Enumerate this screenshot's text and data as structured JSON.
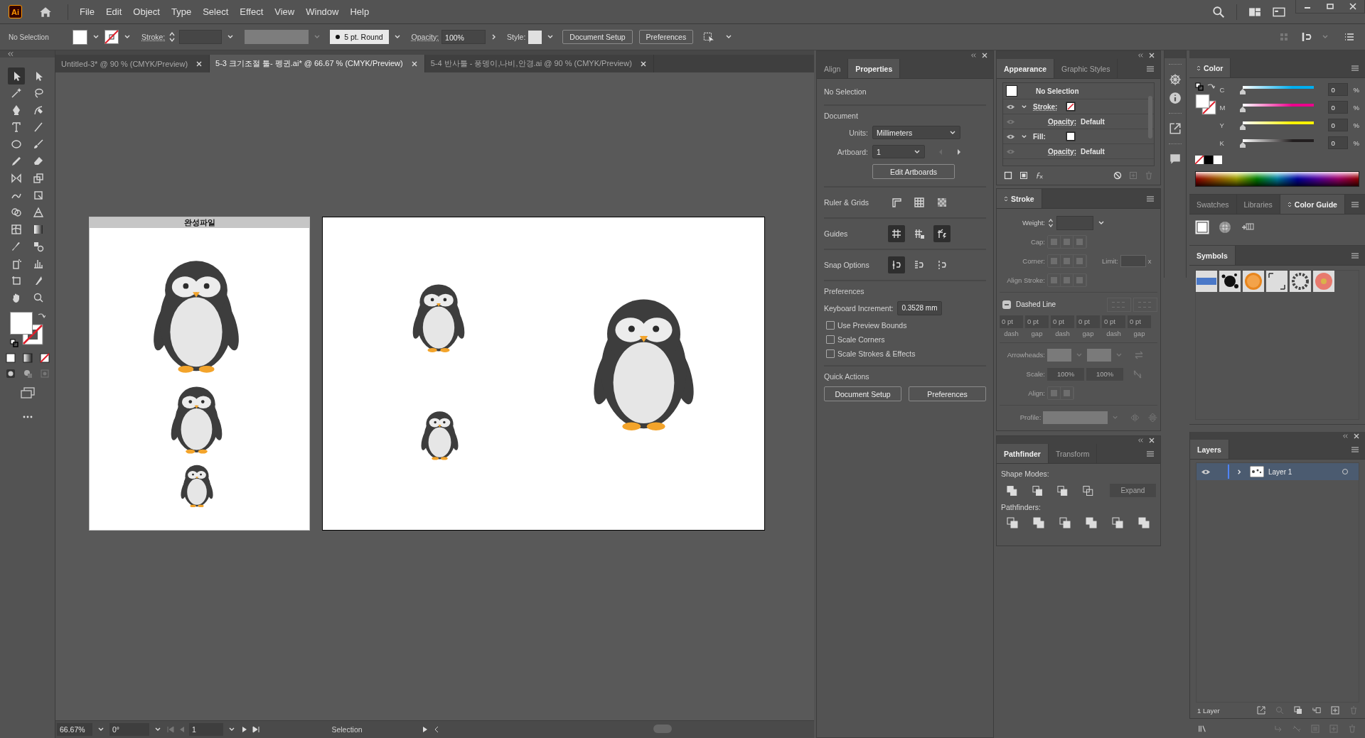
{
  "app": {
    "logo": "Ai"
  },
  "menu": [
    "File",
    "Edit",
    "Object",
    "Type",
    "Select",
    "Effect",
    "View",
    "Window",
    "Help"
  ],
  "control_bar": {
    "selection": "No Selection",
    "stroke_label": "Stroke:",
    "brush": "5 pt. Round",
    "opacity_label": "Opacity:",
    "opacity": "100%",
    "style_label": "Style:",
    "buttons": [
      "Document Setup",
      "Preferences"
    ]
  },
  "document_tabs": [
    {
      "label": "Untitled-3* @ 90 % (CMYK/Preview)",
      "selected": false
    },
    {
      "label": "5-3 크기조절 툴- 펭귄.ai* @ 66.67 % (CMYK/Preview)",
      "selected": true
    },
    {
      "label": "5-4 반사툴 - 풍뎅이,나비,안경.ai @ 90 % (CMYK/Preview)",
      "selected": false
    }
  ],
  "artboards": [
    {
      "kind": "titled",
      "title": "완성파일"
    },
    {
      "kind": "plain"
    }
  ],
  "properties": {
    "tabs": [
      {
        "label": "Align",
        "selected": false
      },
      {
        "label": "Properties",
        "selected": true
      }
    ],
    "selection": "No Selection",
    "document_heading": "Document",
    "units_label": "Units:",
    "units": "Millimeters",
    "artboard_label": "Artboard:",
    "artboard": "1",
    "edit_button": "Edit Artboards",
    "rows": [
      {
        "label": "Ruler & Grids",
        "icons": [
          {
            "on": false
          },
          {
            "on": false
          },
          {
            "on": false
          }
        ]
      },
      {
        "label": "Guides",
        "icons": [
          {
            "on": true
          },
          {
            "on": false
          },
          {
            "on": true
          }
        ]
      },
      {
        "label": "Snap Options",
        "icons": [
          {
            "on": true
          },
          {
            "on": false
          },
          {
            "on": false
          }
        ]
      }
    ],
    "preferences_heading": "Preferences",
    "keyboard_label": "Keyboard Increment:",
    "keyboard_value": "0.3528 mm",
    "checkboxes": [
      {
        "label": "Use Preview Bounds",
        "checked": false
      },
      {
        "label": "Scale Corners",
        "checked": false
      },
      {
        "label": "Scale Strokes & Effects",
        "checked": false
      }
    ],
    "quick_actions_heading": "Quick Actions",
    "quick_buttons": [
      "Document Setup",
      "Preferences"
    ]
  },
  "appearance": {
    "tabs": [
      {
        "label": "Appearance",
        "selected": true
      },
      {
        "label": "Graphic Styles",
        "selected": false
      }
    ],
    "title": "No Selection",
    "rows": [
      {
        "kind": "stroke",
        "label": "Stroke:"
      },
      {
        "kind": "opacity",
        "label": "Opacity:",
        "value": "Default"
      },
      {
        "kind": "fill",
        "label": "Fill:"
      },
      {
        "kind": "opacity",
        "label": "Opacity:",
        "value": "Default"
      }
    ]
  },
  "stroke": {
    "title": "Stroke",
    "weight_label": "Weight:",
    "cap_label": "Cap:",
    "corner_label": "Corner:",
    "limit_label": "Limit:",
    "limit_unit": "x",
    "align_label": "Align Stroke:",
    "dashed_label": "Dashed Line",
    "dashed_checked": true,
    "dashes": [
      {
        "value": "0 pt",
        "label": "dash"
      },
      {
        "value": "0 pt",
        "label": "gap"
      },
      {
        "value": "0 pt",
        "label": "dash"
      },
      {
        "value": "0 pt",
        "label": "gap"
      },
      {
        "value": "0 pt",
        "label": "dash"
      },
      {
        "value": "0 pt",
        "label": "gap"
      }
    ],
    "arrowheads_label": "Arrowheads:",
    "scale_label": "Scale:",
    "scales": [
      "100%",
      "100%"
    ],
    "arrow_align_label": "Align:",
    "profile_label": "Profile:"
  },
  "pathfinder": {
    "tabs": [
      {
        "label": "Pathfinder",
        "selected": true
      },
      {
        "label": "Transform",
        "selected": false
      }
    ],
    "shape_modes": "Shape Modes:",
    "expand": "Expand",
    "pathfinders": "Pathfinders:"
  },
  "color": {
    "title": "Color",
    "channels": [
      {
        "name": "C",
        "value": "0",
        "unit": "%",
        "color": "#00aeef",
        "level": 0
      },
      {
        "name": "M",
        "value": "0",
        "unit": "%",
        "color": "#ec008c",
        "level": 0
      },
      {
        "name": "Y",
        "value": "0",
        "unit": "%",
        "color": "#fff200",
        "level": 0
      },
      {
        "name": "K",
        "value": "0",
        "unit": "%",
        "color": "#231f20",
        "level": 0
      }
    ]
  },
  "swatch_tabs": [
    {
      "label": "Swatches",
      "selected": false
    },
    {
      "label": "Libraries",
      "selected": false
    },
    {
      "label": "Color Guide",
      "selected": true
    }
  ],
  "symbols": {
    "title": "Symbols"
  },
  "layers": {
    "title": "Layers",
    "items": [
      {
        "name": "Layer 1",
        "visible": true,
        "selected": true,
        "expanded": false
      }
    ],
    "count": "1 Layer"
  },
  "status_bar": {
    "zoom": "66.67%",
    "rotation": "0°",
    "artboard": "1",
    "tool": "Selection"
  }
}
